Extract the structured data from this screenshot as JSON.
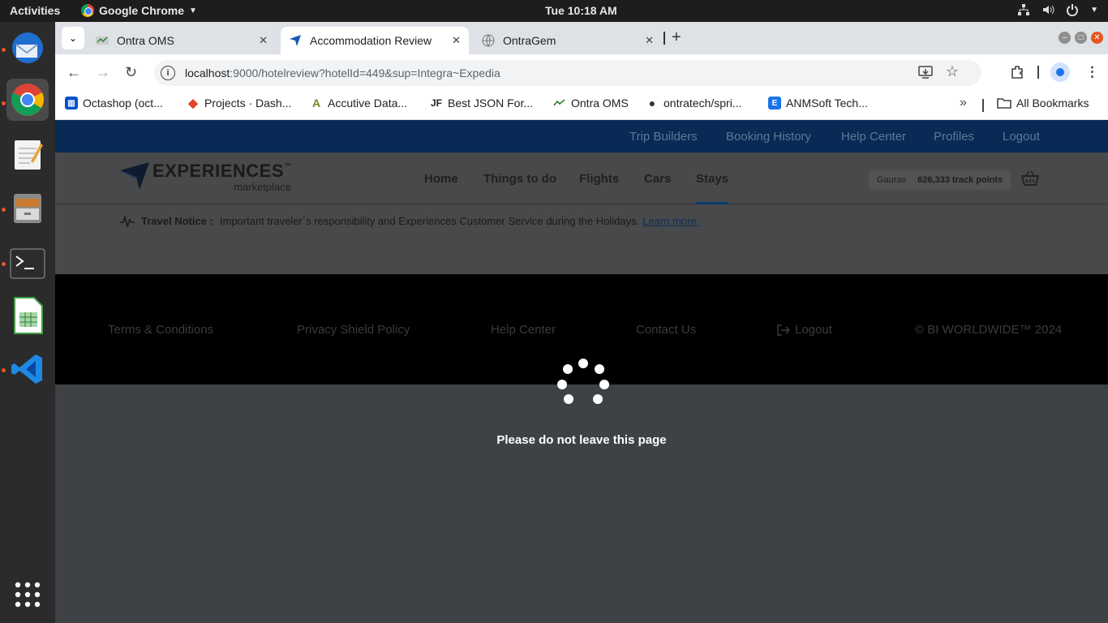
{
  "system": {
    "activities": "Activities",
    "app_name": "Google Chrome",
    "clock": "Tue 10:18 AM"
  },
  "dock": {
    "items": [
      "thunderbird-icon",
      "chrome-icon",
      "text-editor-icon",
      "file-manager-icon",
      "terminal-icon",
      "spreadsheet-icon",
      "vscode-icon",
      "app-grid-icon"
    ]
  },
  "browser": {
    "tabs": [
      {
        "label": "Ontra OMS",
        "active": false
      },
      {
        "label": "Accommodation Review",
        "active": true
      },
      {
        "label": "OntraGem",
        "active": false
      }
    ],
    "url_host": "localhost",
    "url_path": ":9000/hotelreview?hotelId=449&sup=Integra~Expedia",
    "bookmarks": [
      {
        "label": "Octashop (oct...",
        "color": "#0052cc"
      },
      {
        "label": "Projects · Dash...",
        "color": "#e24329"
      },
      {
        "label": "Accutive Data...",
        "color": "#6b8e23"
      },
      {
        "label": "Best JSON For...",
        "color": "#222222"
      },
      {
        "label": "Ontra OMS",
        "color": "#2e7d32"
      },
      {
        "label": "ontratech/spri...",
        "color": "#333333"
      },
      {
        "label": "ANMSoft Tech...",
        "color": "#1a73e8"
      }
    ],
    "all_bookmarks": "All Bookmarks"
  },
  "site": {
    "utility_nav": [
      "Trip Builders",
      "Booking History",
      "Help Center",
      "Profiles",
      "Logout"
    ],
    "logo_main": "EXPERIENCES",
    "logo_tm": "™",
    "logo_sub": "marketplace",
    "main_nav": [
      "Home",
      "Things to do",
      "Flights",
      "Cars",
      "Stays"
    ],
    "active_nav": "Stays",
    "user_name": "Gaurav",
    "points": "626,333",
    "points_label": "track points",
    "notice_label": "Travel Notice :",
    "notice_text": "Important traveler`s responsibility and Experiences Customer Service during the Holidays.",
    "notice_link": "Learn more.",
    "footer_links": [
      "Terms & Conditions",
      "Privacy Shield Policy",
      "Help Center",
      "Contact Us",
      "Logout"
    ],
    "copyright": "© BI WORLDWIDE™ 2024",
    "loader_message": "Please do not leave this page"
  },
  "colors": {
    "utility_bar": "#082a55",
    "overlay": "#3f4245",
    "footer": "#000000"
  }
}
